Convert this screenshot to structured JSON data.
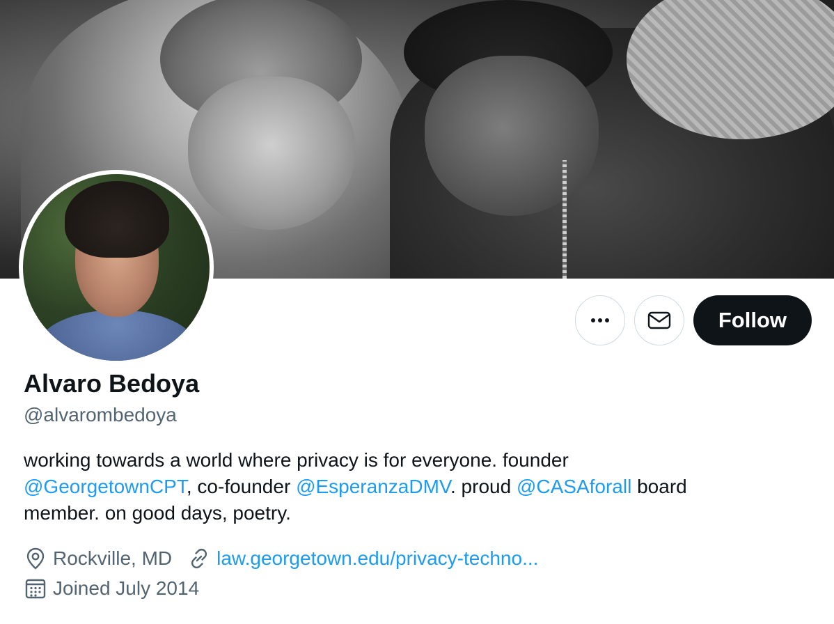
{
  "profile": {
    "name": "Alvaro Bedoya",
    "handle": "@alvarombedoya",
    "bio": {
      "line1": "working towards a world where privacy is for everyone. founder",
      "mention1": "@GeorgetownCPT",
      "text2": ", co-founder ",
      "mention2": "@EsperanzaDMV",
      "text3": ". proud ",
      "mention3": "@CASAforall",
      "text4": " board",
      "line3": "member. on good days, poetry."
    },
    "location": "Rockville, MD",
    "website": "law.georgetown.edu/privacy-techno...",
    "joined": "Joined July 2014"
  },
  "actions": {
    "more_icon": "more-horizontal-icon",
    "message_icon": "envelope-icon",
    "follow_label": "Follow"
  },
  "icons": {
    "location": "location-pin-icon",
    "link": "link-icon",
    "calendar": "calendar-icon"
  },
  "colors": {
    "accent": "#1d9bf0",
    "text_primary": "#0f1419",
    "text_secondary": "#536471",
    "follow_bg": "#0f1419",
    "border": "#cfd9de"
  }
}
